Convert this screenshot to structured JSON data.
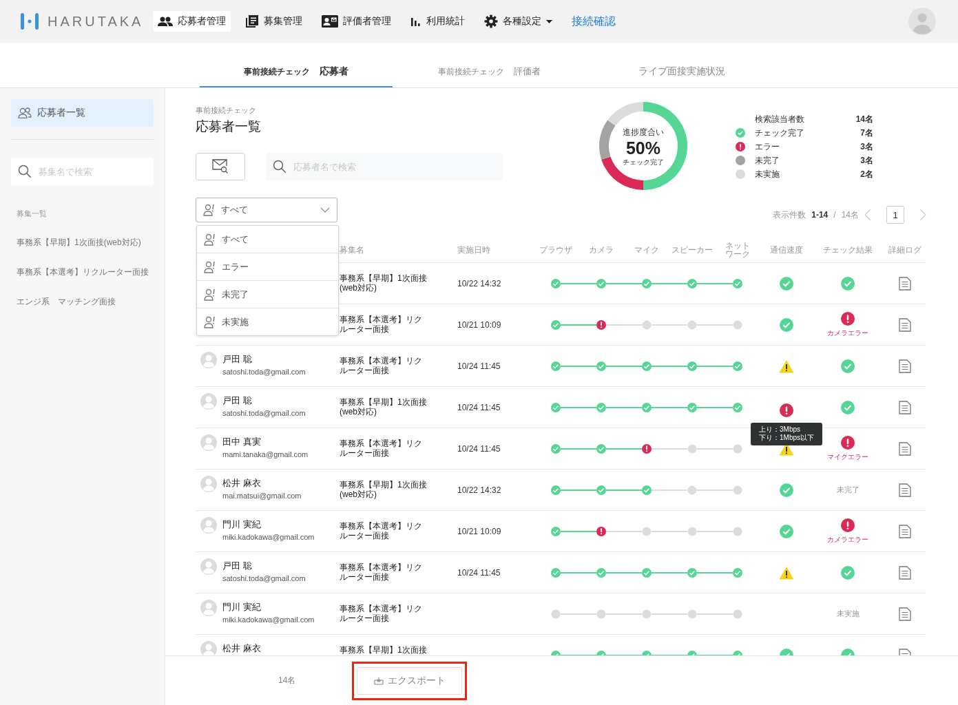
{
  "header": {
    "logo": "HARUTAKA",
    "nav": [
      {
        "kind": "people",
        "label": "応募者管理",
        "selected": true
      },
      {
        "kind": "docs",
        "label": "募集管理",
        "selected": false
      },
      {
        "kind": "card",
        "label": "評価者管理",
        "selected": false
      },
      {
        "kind": "chart",
        "label": "利用統計",
        "selected": false
      },
      {
        "kind": "settings",
        "label": "各種設定",
        "selected": false
      },
      {
        "kind": "link",
        "label": "接続確認",
        "selected": false
      }
    ]
  },
  "subtabs": [
    {
      "prefix": "事前接続チェック",
      "label": "応募者",
      "selected": true
    },
    {
      "prefix": "事前接続チェック",
      "label": "評価者",
      "selected": false
    },
    {
      "label": "ライブ面接実施状況",
      "selected": false
    }
  ],
  "sidebar": {
    "items": [
      {
        "label": "応募者一覧",
        "selected": true
      }
    ],
    "search": {
      "placeholder": "募集名で検索"
    },
    "section_title": "募集一覧",
    "recruitments": [
      "事務系【早期】1次面接(web対応)",
      "事務系【本選考】リクルーター面接",
      "エンジ系　マッチング面接"
    ]
  },
  "main": {
    "breadcrumb": "事前接続チェック",
    "title": "応募者一覧",
    "search": {
      "placeholder": "応募者名で検索"
    },
    "filter": {
      "value": "すべて",
      "expanded": true,
      "options": [
        "すべて",
        "エラー",
        "未完了",
        "未実施"
      ]
    },
    "summary": {
      "center_label": "進捗度合い",
      "percent": "50%",
      "center_caption": "チェック完了",
      "total": {
        "label": "検索該当者数",
        "count": "14名"
      },
      "legend": [
        {
          "kind": "check",
          "count": "7名",
          "color": "#55d695"
        },
        {
          "kind": "error",
          "count": "3名",
          "color": "#d92b55"
        },
        {
          "kind": "dot",
          "count": "3名",
          "color": "#a3a3a3"
        },
        {
          "kind": "dot",
          "count": "2名",
          "color": "#dcdcdc"
        }
      ],
      "chart_data": {
        "type": "donut",
        "categories": [
          "チェック完了",
          "エラー",
          "未完了",
          "未実施"
        ],
        "values": [
          50,
          20,
          15,
          15
        ]
      }
    },
    "pagination": {
      "label": "表示件数",
      "range": "1-14",
      "separator": "/",
      "total": "14名",
      "page": "1"
    },
    "table": {
      "columns": [
        "募集名",
        "実施日時",
        "ブラウザ",
        "カメラ",
        "マイク",
        "スピーカー",
        "ネットワーク",
        "通信速度",
        "チェック結果",
        "詳細ログ"
      ],
      "rows": [
        {
          "recruitment": "事務系【早期】1次面接(web対応)",
          "date": "10/22 14:32",
          "steps": [
            {
              "kind": "ok"
            },
            {
              "kind": "ok"
            },
            {
              "kind": "ok"
            },
            {
              "kind": "ok"
            },
            {
              "kind": "ok"
            }
          ],
          "speed": {
            "kind": "ok"
          },
          "result": {
            "kind": "ok"
          }
        },
        {
          "recruitment": "事務系【本選考】リクルーター面接",
          "date": "10/21 10:09",
          "steps": [
            {
              "kind": "ok"
            },
            {
              "kind": "error"
            },
            {
              "kind": "pending"
            },
            {
              "kind": "pending"
            },
            {
              "kind": "pending"
            }
          ],
          "speed": {
            "kind": "ok"
          },
          "result": {
            "kind": "error",
            "text": "カメラエラー"
          }
        },
        {
          "name": "戸田 聡",
          "email": "satoshi.toda@gmail.com",
          "recruitment": "事務系【本選考】リクルーター面接",
          "date": "10/24 11:45",
          "steps": [
            {
              "kind": "ok"
            },
            {
              "kind": "ok"
            },
            {
              "kind": "ok"
            },
            {
              "kind": "ok"
            },
            {
              "kind": "ok"
            }
          ],
          "speed": {
            "kind": "warn"
          },
          "result": {
            "kind": "ok"
          }
        },
        {
          "name": "戸田 聡",
          "email": "satoshi.toda@gmail.com",
          "recruitment": "事務系【早期】1次面接(web対応)",
          "date": "10/24 11:45",
          "steps": [
            {
              "kind": "ok"
            },
            {
              "kind": "ok"
            },
            {
              "kind": "ok"
            },
            {
              "kind": "ok"
            },
            {
              "kind": "ok"
            }
          ],
          "speed": {
            "kind": "error",
            "tooltip": [
              "上り：3Mbps",
              "下り：1Mbps以下"
            ]
          },
          "result": {
            "kind": "ok"
          }
        },
        {
          "name": "田中 真実",
          "email": "mami.tanaka@gmail.com",
          "recruitment": "事務系【本選考】リクルーター面接",
          "date": "10/24 11:45",
          "steps": [
            {
              "kind": "ok"
            },
            {
              "kind": "ok"
            },
            {
              "kind": "error"
            },
            {
              "kind": "pending"
            },
            {
              "kind": "pending"
            }
          ],
          "speed": {
            "kind": "warn"
          },
          "result": {
            "kind": "error",
            "text": "マイクエラー"
          }
        },
        {
          "name": "松井 麻衣",
          "email": "mai.matsui@gmail.com",
          "recruitment": "事務系【早期】1次面接(web対応)",
          "date": "10/22 14:32",
          "steps": [
            {
              "kind": "ok"
            },
            {
              "kind": "ok"
            },
            {
              "kind": "ok"
            },
            {
              "kind": "pending"
            },
            {
              "kind": "pending"
            }
          ],
          "speed": {
            "kind": "ok"
          },
          "result": {
            "kind": "text",
            "text": "未完了"
          }
        },
        {
          "name": "門川 実紀",
          "email": "miki.kadokawa@gmail.com",
          "recruitment": "事務系【本選考】リクルーター面接",
          "date": "10/21 10:09",
          "steps": [
            {
              "kind": "ok"
            },
            {
              "kind": "error"
            },
            {
              "kind": "pending"
            },
            {
              "kind": "pending"
            },
            {
              "kind": "pending"
            }
          ],
          "speed": {
            "kind": "ok"
          },
          "result": {
            "kind": "error",
            "text": "カメラエラー"
          }
        },
        {
          "name": "戸田 聡",
          "email": "satoshi.toda@gmail.com",
          "recruitment": "事務系【本選考】リクルーター面接",
          "date": "10/24 11:45",
          "steps": [
            {
              "kind": "ok"
            },
            {
              "kind": "ok"
            },
            {
              "kind": "ok"
            },
            {
              "kind": "ok"
            },
            {
              "kind": "ok"
            }
          ],
          "speed": {
            "kind": "warn"
          },
          "result": {
            "kind": "ok"
          }
        },
        {
          "name": "門川 実紀",
          "email": "miki.kadokawa@gmail.com",
          "recruitment": "事務系【本選考】リクルーター面接",
          "steps": [
            {
              "kind": "pending"
            },
            {
              "kind": "pending"
            },
            {
              "kind": "pending"
            },
            {
              "kind": "pending"
            },
            {
              "kind": "pending"
            }
          ],
          "result": {
            "kind": "text",
            "text": "未実施"
          }
        },
        {
          "name": "松井 麻衣",
          "recruitment": "事務系【早期】1次面接",
          "steps": [
            {
              "kind": "ok"
            },
            {
              "kind": "ok"
            },
            {
              "kind": "ok"
            },
            {
              "kind": "ok"
            },
            {
              "kind": "ok"
            }
          ],
          "speed": {
            "kind": "ok"
          },
          "result": {
            "kind": "ok"
          }
        }
      ]
    },
    "footer": {
      "count": "14名",
      "export": {
        "label": "エクスポート",
        "highlighted": true
      }
    }
  }
}
